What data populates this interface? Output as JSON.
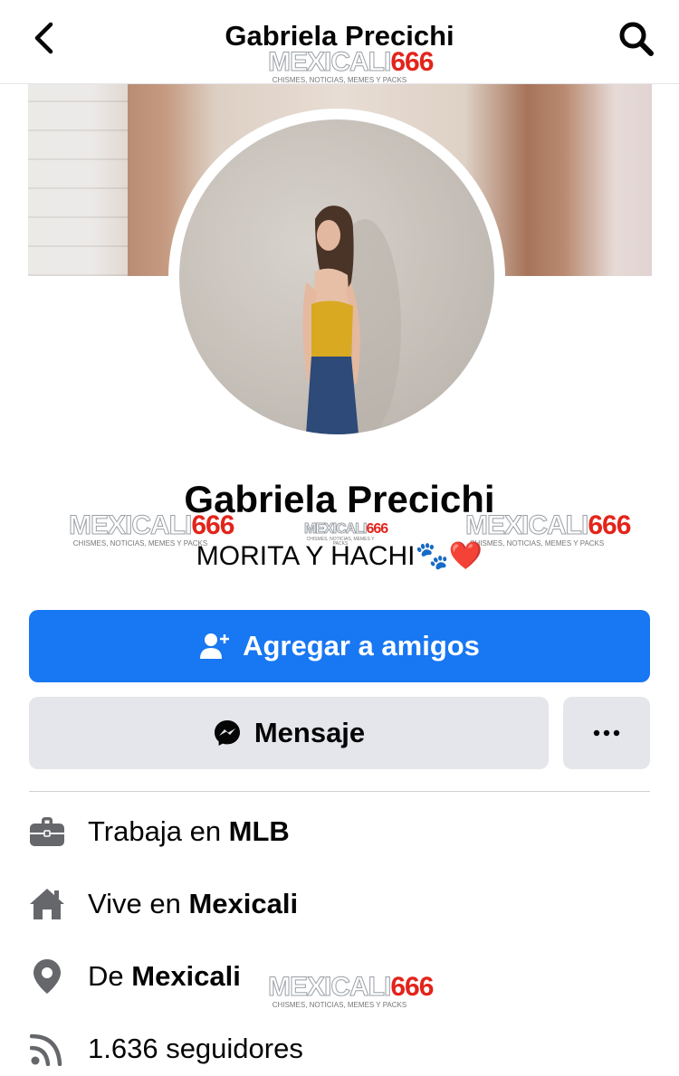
{
  "header": {
    "title": "Gabriela Precichi",
    "back_icon": "chevron-left-icon",
    "search_icon": "search-icon"
  },
  "profile": {
    "name": "Gabriela Precichi",
    "bio": "MORITA Y HACHI",
    "bio_emoji": "🐾❤️"
  },
  "watermark": {
    "brand": "MEXICALI",
    "brand_number": "666",
    "tagline": "CHISMES, NOTICIAS, MEMES Y PACKS"
  },
  "actions": {
    "add_friend": "Agregar a amigos",
    "message": "Mensaje",
    "more": "···"
  },
  "info": {
    "work_prefix": "Trabaja en ",
    "work_value": "MLB",
    "lives_prefix": "Vive en ",
    "lives_value": "Mexicali",
    "from_prefix": "De ",
    "from_value": "Mexicali",
    "followers": "1.636 seguidores"
  },
  "colors": {
    "primary": "#1877f2",
    "secondary_bg": "#e4e6eb",
    "icon_gray": "#65676b",
    "watermark_red": "#e3241b"
  }
}
